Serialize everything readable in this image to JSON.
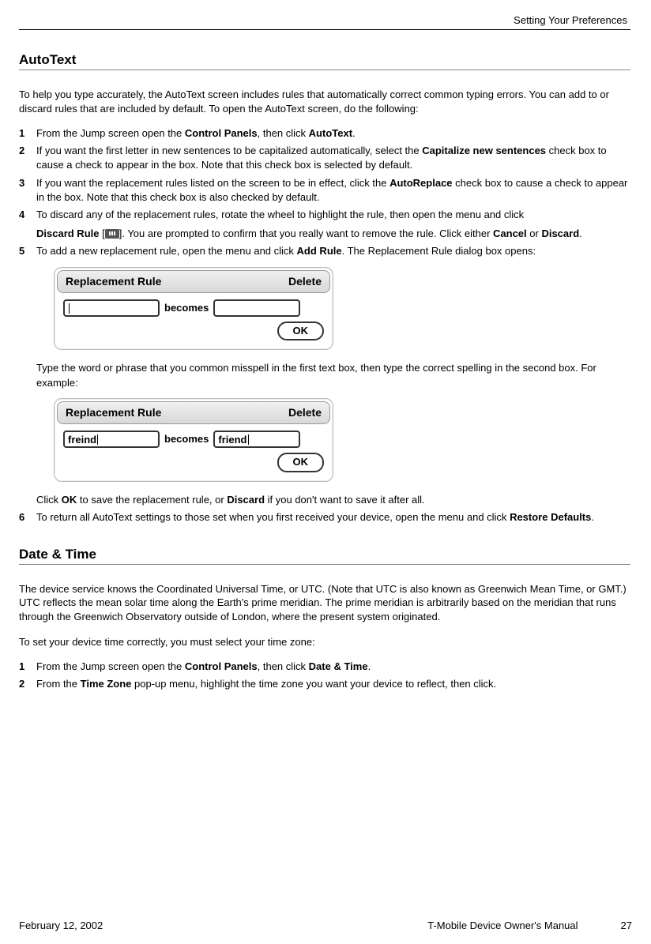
{
  "header": {
    "running_title": "Setting Your Preferences"
  },
  "section_autotext": {
    "heading": "AutoText",
    "intro": "To help you type accurately, the AutoText screen includes rules that automatically correct common typing errors. You can add to or discard rules that are included by default. To open the AutoText screen, do the following:",
    "step1_a": "From the Jump screen open the ",
    "step1_b_bold": "Control Panels",
    "step1_c": ", then click ",
    "step1_d_bold": "AutoText",
    "step1_e": ".",
    "step2_a": "If you want the first letter in new sentences to be capitalized automatically, select the ",
    "step2_b_bold": "Capitalize new sentences",
    "step2_c": " check box to cause a check to appear in the box. Note that this check box is selected by default.",
    "step3_a": "If you want the replacement rules listed on the screen to be in effect, click the ",
    "step3_b_bold": "AutoReplace",
    "step3_c": " check box to cause a check to appear in the box. Note that this check box is also checked by default.",
    "step4_a": "To discard any of the replacement rules, rotate the wheel to highlight the rule, then open the menu and click ",
    "step4_b_bold": "Discard Rule",
    "step4_c": " [",
    "step4_d": "]. You are prompted to confirm that you really want to remove the rule. Click either ",
    "step4_e_bold": "Cancel",
    "step4_f": " or ",
    "step4_g_bold": "Discard",
    "step4_h": ".",
    "step5_a": "To add a new replacement rule, open the menu and click ",
    "step5_b_bold": "Add Rule",
    "step5_c": ". The Replacement Rule dialog box opens:",
    "step5_after_a": "Type the word or phrase that you common misspell in the first text box, then type the correct spelling in the second box. For example:",
    "step5_after_b": "Click ",
    "step5_after_c_bold": "OK",
    "step5_after_d": " to save the replacement rule, or ",
    "step5_after_e_bold": "Discard",
    "step5_after_f": " if you don't want to save it after all.",
    "step6_a": "To return all AutoText settings to those set when you first received your device, open the menu and click ",
    "step6_b_bold": "Restore Defaults",
    "step6_c": "."
  },
  "dialog1": {
    "title": "Replacement Rule",
    "delete": "Delete",
    "becomes": "becomes",
    "left_value": "",
    "right_value": "",
    "ok": "OK"
  },
  "dialog2": {
    "title": "Replacement Rule",
    "delete": "Delete",
    "becomes": "becomes",
    "left_value": "freind",
    "right_value": "friend",
    "ok": "OK"
  },
  "section_datetime": {
    "heading": "Date & Time",
    "intro": "The device service knows the Coordinated Universal Time, or UTC. (Note that UTC is also known as Greenwich Mean Time, or GMT.) UTC reflects the mean solar time along the Earth's prime meridian. The prime meridian is arbitrarily based on the meridian that runs through the Greenwich Observatory outside of London, where the present system originated.",
    "para2": "To set your device time correctly, you must select your time zone:",
    "step1_a": "From the Jump screen open the ",
    "step1_b_bold": "Control Panels",
    "step1_c": ", then click ",
    "step1_d_bold": "Date & Time",
    "step1_e": ".",
    "step2_a": "From the ",
    "step2_b_bold": "Time Zone",
    "step2_c": " pop-up menu, highlight the time zone you want your device to reflect, then click."
  },
  "footer": {
    "date": "February 12, 2002",
    "manual": "T-Mobile Device Owner's Manual",
    "page": "27"
  }
}
